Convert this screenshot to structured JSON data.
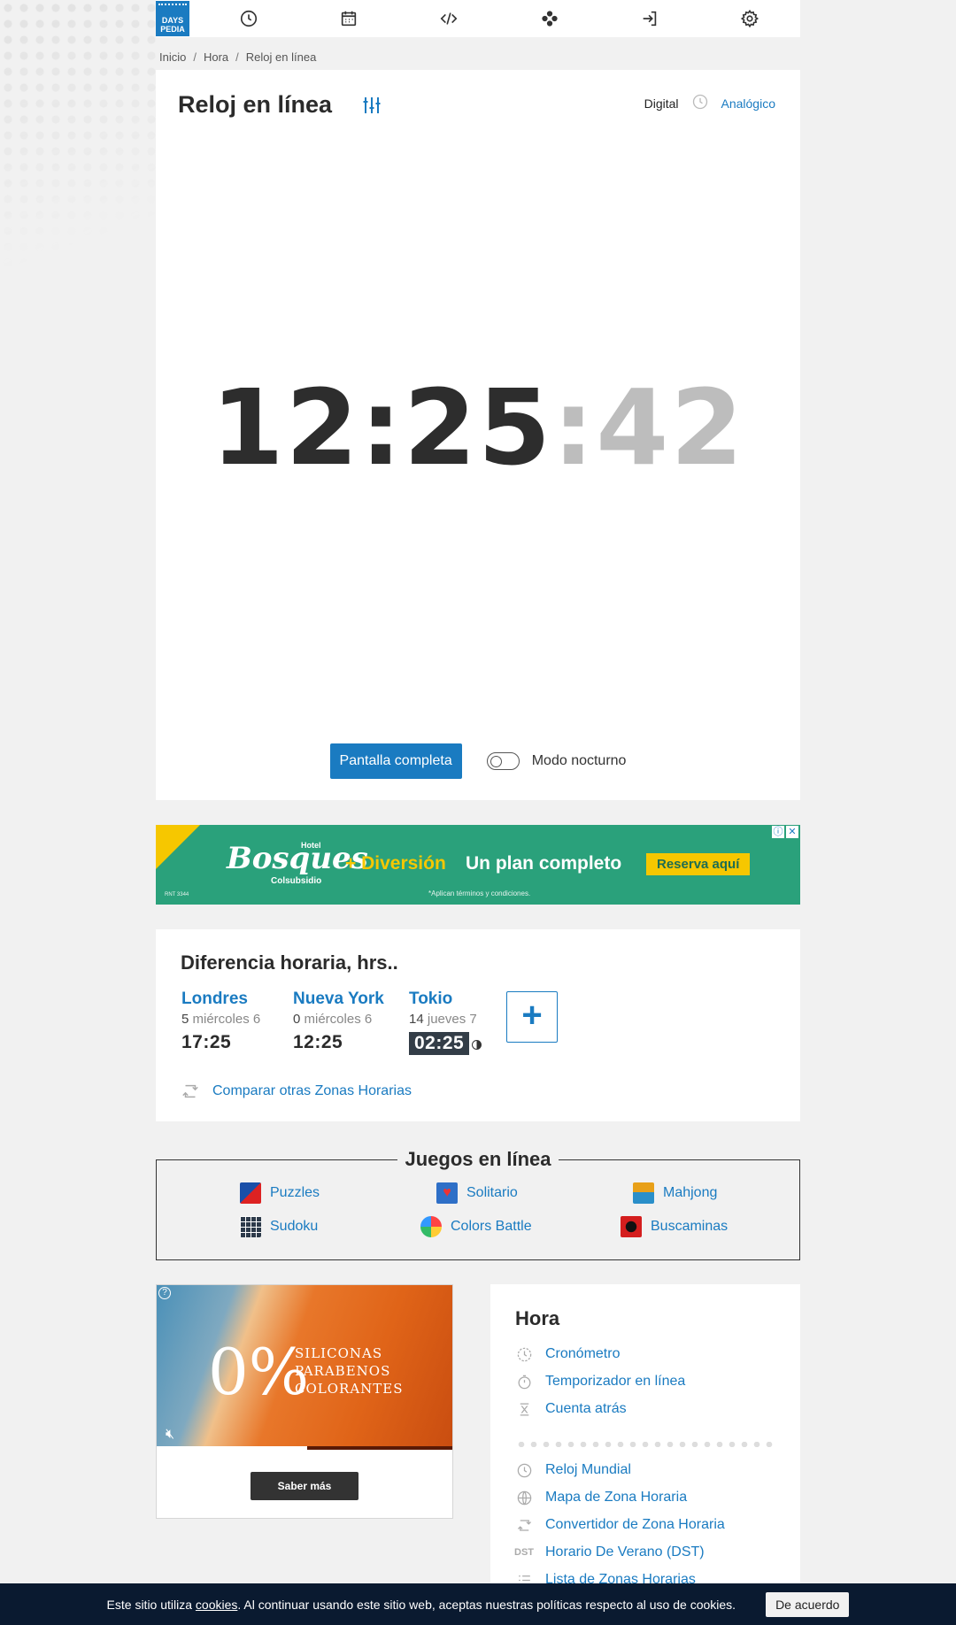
{
  "nav": {
    "logo_line1": "DAYS",
    "logo_line2": "PEDIA",
    "icons": [
      "clock-icon",
      "calendar-icon",
      "code-icon",
      "games-icon",
      "login-icon",
      "gear-icon"
    ]
  },
  "breadcrumb": [
    "Inicio",
    "Hora",
    "Reloj en línea"
  ],
  "clock": {
    "title": "Reloj en línea",
    "view_digital": "Digital",
    "view_analog": "Analógico",
    "hours_minutes": "12:25",
    "seconds": ":42",
    "fullscreen_label": "Pantalla completa",
    "night_mode_label": "Modo nocturno",
    "night_mode_on": false
  },
  "ad_banner": {
    "brand": "Bosques",
    "brand_hotel": "Hotel",
    "brand_sub": "Colsubsidio",
    "diversion": "+ Diversión",
    "plan": "Un plan completo",
    "cta": "Reserva aquí",
    "terms": "*Aplican términos y condiciones.",
    "rnt": "RNT 3344"
  },
  "time_diff": {
    "title": "Diferencia horaria, hrs..",
    "cities": [
      {
        "name": "Londres",
        "offset": "5",
        "day": "miércoles 6",
        "time": "17:25",
        "night": false
      },
      {
        "name": "Nueva York",
        "offset": "0",
        "day": "miércoles 6",
        "time": "12:25",
        "night": false
      },
      {
        "name": "Tokio",
        "offset": "14",
        "day": "jueves 7",
        "time": "02:25",
        "night": true
      }
    ],
    "add_label": "+",
    "compare_label": "Comparar otras Zonas Horarias"
  },
  "games": {
    "title": "Juegos en línea",
    "items": [
      {
        "label": "Puzzles",
        "icon": "puzzle-icon"
      },
      {
        "label": "Solitario",
        "icon": "solitaire-icon"
      },
      {
        "label": "Mahjong",
        "icon": "mahjong-icon"
      },
      {
        "label": "Sudoku",
        "icon": "sudoku-icon"
      },
      {
        "label": "Colors Battle",
        "icon": "colors-battle-icon"
      },
      {
        "label": "Buscaminas",
        "icon": "minesweeper-icon"
      }
    ]
  },
  "video_ad": {
    "big_text": "0%",
    "line1": "SILICONAS",
    "line2": "PARABENOS",
    "line3": "COLORANTES",
    "cta": "Saber más",
    "progress": 0.51
  },
  "hora": {
    "title": "Hora",
    "items_top": [
      {
        "label": "Cronómetro",
        "icon": "stopwatch-icon"
      },
      {
        "label": "Temporizador en línea",
        "icon": "timer-icon"
      },
      {
        "label": "Cuenta atrás",
        "icon": "countdown-icon"
      }
    ],
    "items_bottom": [
      {
        "label": "Reloj Mundial",
        "icon": "clock-icon"
      },
      {
        "label": "Mapa de Zona Horaria",
        "icon": "globe-icon"
      },
      {
        "label": "Convertidor de Zona Horaria",
        "icon": "convert-icon"
      },
      {
        "label": "Horario De Verano (DST)",
        "icon": "dst-icon",
        "text_icon": "DST"
      },
      {
        "label": "Lista de Zonas Horarias",
        "icon": "list-icon"
      }
    ]
  },
  "cookie": {
    "text_before": "Este sitio utiliza ",
    "link": "cookies",
    "text_after": ". Al continuar usando este sitio web, aceptas nuestras políticas respecto al uso de cookies.",
    "accept": "De acuerdo"
  },
  "colors": {
    "accent": "#1a7bc1",
    "ad_green": "#2aa17b",
    "ad_yellow": "#f6c700",
    "cookie_bg": "#0a1a30"
  }
}
